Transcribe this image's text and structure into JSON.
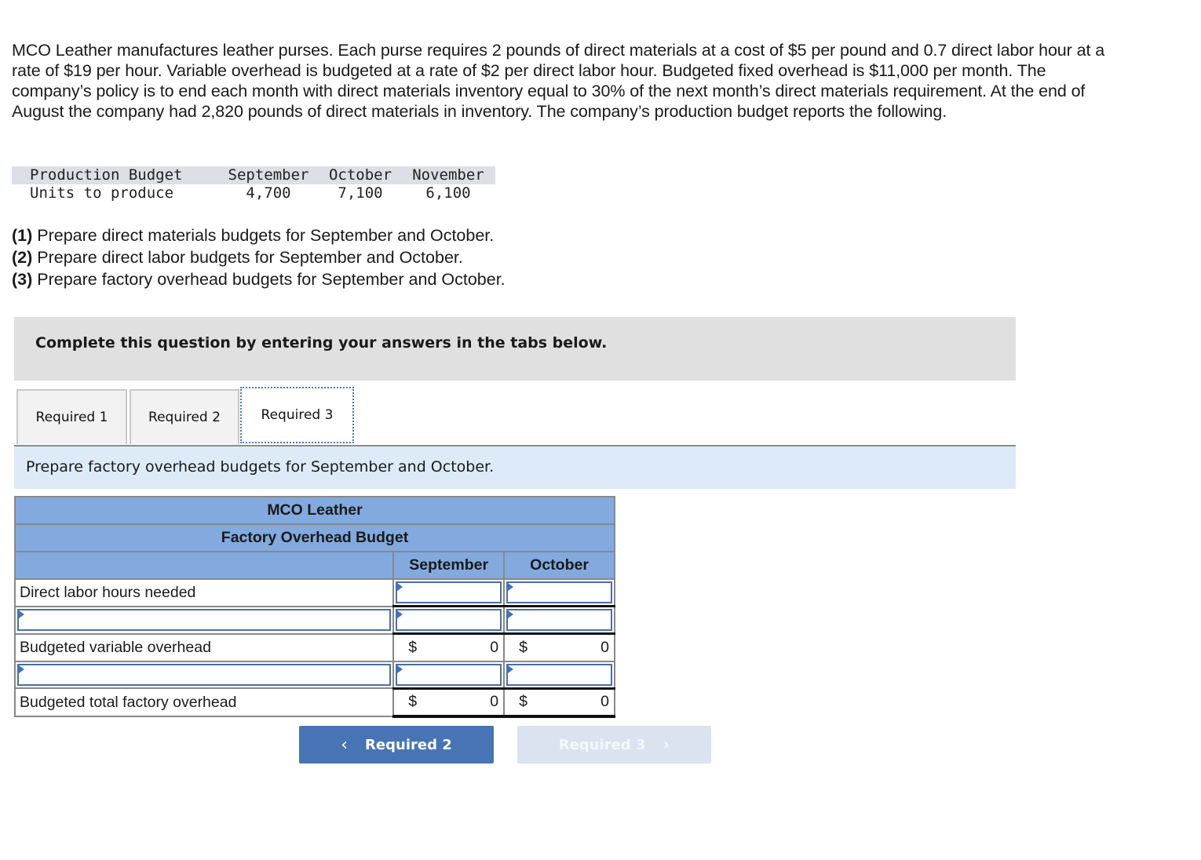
{
  "problem": {
    "intro": "MCO Leather manufactures leather purses. Each purse requires 2 pounds of direct materials at a cost of $5 per pound and 0.7 direct labor hour at a rate of $19 per hour. Variable overhead is budgeted at a rate of $2 per direct labor hour. Budgeted fixed overhead is $11,000 per month. The company’s policy is to end each month with direct materials inventory equal to 30% of the next month’s direct materials requirement. At the end of August the company had 2,820 pounds of direct materials in inventory. The company’s production budget reports the following.",
    "production_budget": {
      "headers": [
        "Production Budget",
        "September",
        "October",
        "November"
      ],
      "row": [
        "Units to produce",
        "4,700",
        "7,100",
        "6,100"
      ]
    },
    "requirements": [
      {
        "num": "(1)",
        "text": " Prepare direct materials budgets for September and October."
      },
      {
        "num": "(2)",
        "text": " Prepare direct labor budgets for September and October."
      },
      {
        "num": "(3)",
        "text": " Prepare factory overhead budgets for September and October."
      }
    ]
  },
  "banner": "Complete this question by entering your answers in the tabs below.",
  "tabs": [
    {
      "label": "Required 1",
      "active": false
    },
    {
      "label": "Required 2",
      "active": false
    },
    {
      "label": "Required 3",
      "active": true
    }
  ],
  "instruction": "Prepare factory overhead budgets for September and October.",
  "budget": {
    "company": "MCO Leather",
    "title": "Factory Overhead Budget",
    "columns": [
      "September",
      "October"
    ],
    "rows": [
      {
        "label": "Direct labor hours needed",
        "september": "",
        "october": ""
      },
      {
        "label": "",
        "september": "",
        "october": ""
      },
      {
        "label": "Budgeted variable overhead",
        "currency": "$",
        "september": "0",
        "october": "0"
      },
      {
        "label": "",
        "september": "",
        "october": ""
      },
      {
        "label": "Budgeted total factory overhead",
        "currency": "$",
        "september": "0",
        "october": "0"
      }
    ]
  },
  "nav": {
    "prev_label": "Required 2",
    "next_label": "Required 3",
    "prev_icon": "chevron-left-icon",
    "next_icon": "chevron-right-icon"
  }
}
